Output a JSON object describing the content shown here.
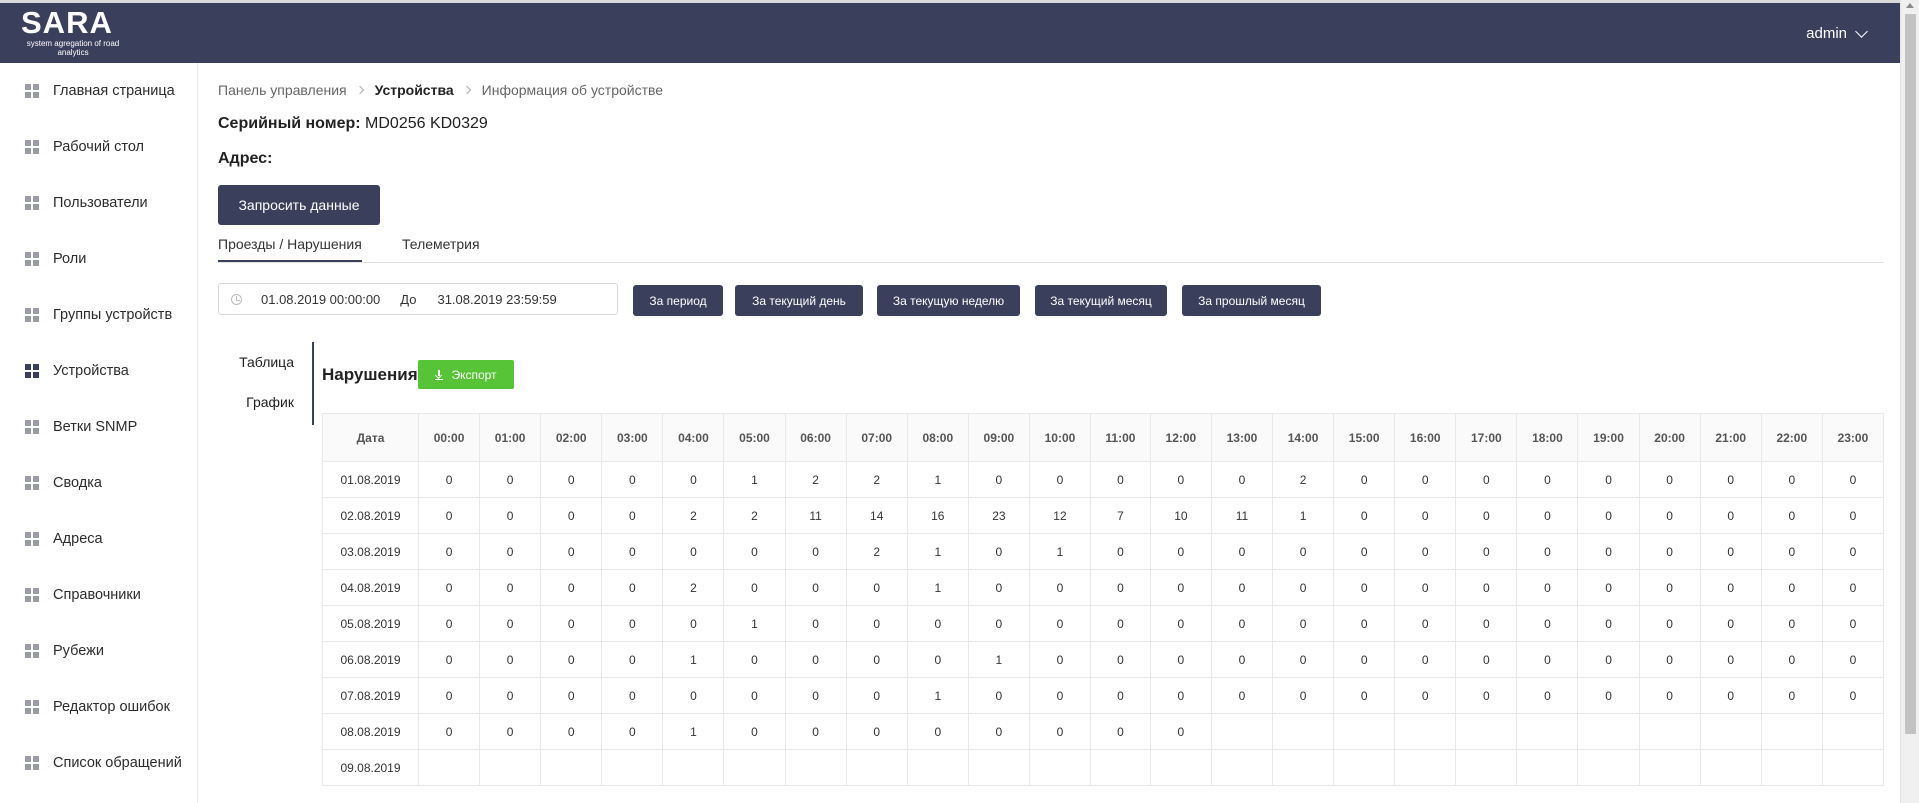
{
  "header": {
    "logo_title": "SARA",
    "logo_subtitle": "system agregation of road analytics",
    "user": "admin"
  },
  "sidebar": {
    "items": [
      {
        "label": "Главная страница"
      },
      {
        "label": "Рабочий стол"
      },
      {
        "label": "Пользователи"
      },
      {
        "label": "Роли"
      },
      {
        "label": "Группы устройств"
      },
      {
        "label": "Устройства",
        "active": true
      },
      {
        "label": "Ветки SNMP"
      },
      {
        "label": "Сводка"
      },
      {
        "label": "Адреса"
      },
      {
        "label": "Справочники"
      },
      {
        "label": "Рубежи"
      },
      {
        "label": "Редактор ошибок"
      },
      {
        "label": "Список обращений"
      }
    ]
  },
  "breadcrumb": [
    "Панель управления",
    "Устройства",
    "Информация об устройстве"
  ],
  "device": {
    "serial_label": "Серийный номер:",
    "serial_value": "MD0256 KD0329",
    "address_label": "Адрес:"
  },
  "request_button": "Запросить данные",
  "tabs": [
    "Проезды / Нарушения",
    "Телеметрия"
  ],
  "date_range": {
    "from": "01.08.2019 00:00:00",
    "to_label": "До",
    "to": "31.08.2019 23:59:59"
  },
  "period_buttons": [
    "За период",
    "За текущий день",
    "За текущую неделю",
    "За текущий месяц",
    "За прошлый месяц"
  ],
  "view_tabs": [
    "Таблица",
    "График"
  ],
  "section_title": "Нарушения",
  "export_button": "Экспорт",
  "table": {
    "date_header": "Дата",
    "hours": [
      "00:00",
      "01:00",
      "02:00",
      "03:00",
      "04:00",
      "05:00",
      "06:00",
      "07:00",
      "08:00",
      "09:00",
      "10:00",
      "11:00",
      "12:00",
      "13:00",
      "14:00",
      "15:00",
      "16:00",
      "17:00",
      "18:00",
      "19:00",
      "20:00",
      "21:00",
      "22:00",
      "23:00"
    ],
    "rows": [
      {
        "date": "01.08.2019",
        "values": [
          0,
          0,
          0,
          0,
          0,
          1,
          2,
          2,
          1,
          0,
          0,
          0,
          0,
          0,
          2,
          0,
          0,
          0,
          0,
          0,
          0,
          0,
          0,
          0
        ]
      },
      {
        "date": "02.08.2019",
        "values": [
          0,
          0,
          0,
          0,
          2,
          2,
          11,
          14,
          16,
          23,
          12,
          7,
          10,
          11,
          1,
          0,
          0,
          0,
          0,
          0,
          0,
          0,
          0,
          0
        ]
      },
      {
        "date": "03.08.2019",
        "values": [
          0,
          0,
          0,
          0,
          0,
          0,
          0,
          2,
          1,
          0,
          1,
          0,
          0,
          0,
          0,
          0,
          0,
          0,
          0,
          0,
          0,
          0,
          0,
          0
        ]
      },
      {
        "date": "04.08.2019",
        "values": [
          0,
          0,
          0,
          0,
          2,
          0,
          0,
          0,
          1,
          0,
          0,
          0,
          0,
          0,
          0,
          0,
          0,
          0,
          0,
          0,
          0,
          0,
          0,
          0
        ]
      },
      {
        "date": "05.08.2019",
        "values": [
          0,
          0,
          0,
          0,
          0,
          1,
          0,
          0,
          0,
          0,
          0,
          0,
          0,
          0,
          0,
          0,
          0,
          0,
          0,
          0,
          0,
          0,
          0,
          0
        ]
      },
      {
        "date": "06.08.2019",
        "values": [
          0,
          0,
          0,
          0,
          1,
          0,
          0,
          0,
          0,
          1,
          0,
          0,
          0,
          0,
          0,
          0,
          0,
          0,
          0,
          0,
          0,
          0,
          0,
          0
        ]
      },
      {
        "date": "07.08.2019",
        "values": [
          0,
          0,
          0,
          0,
          0,
          0,
          0,
          0,
          1,
          0,
          0,
          0,
          0,
          0,
          0,
          0,
          0,
          0,
          0,
          0,
          0,
          0,
          0,
          0
        ]
      },
      {
        "date": "08.08.2019",
        "values": [
          0,
          0,
          0,
          0,
          1,
          0,
          0,
          0,
          0,
          0,
          0,
          0,
          0
        ]
      },
      {
        "date": "09.08.2019",
        "values": []
      }
    ]
  }
}
